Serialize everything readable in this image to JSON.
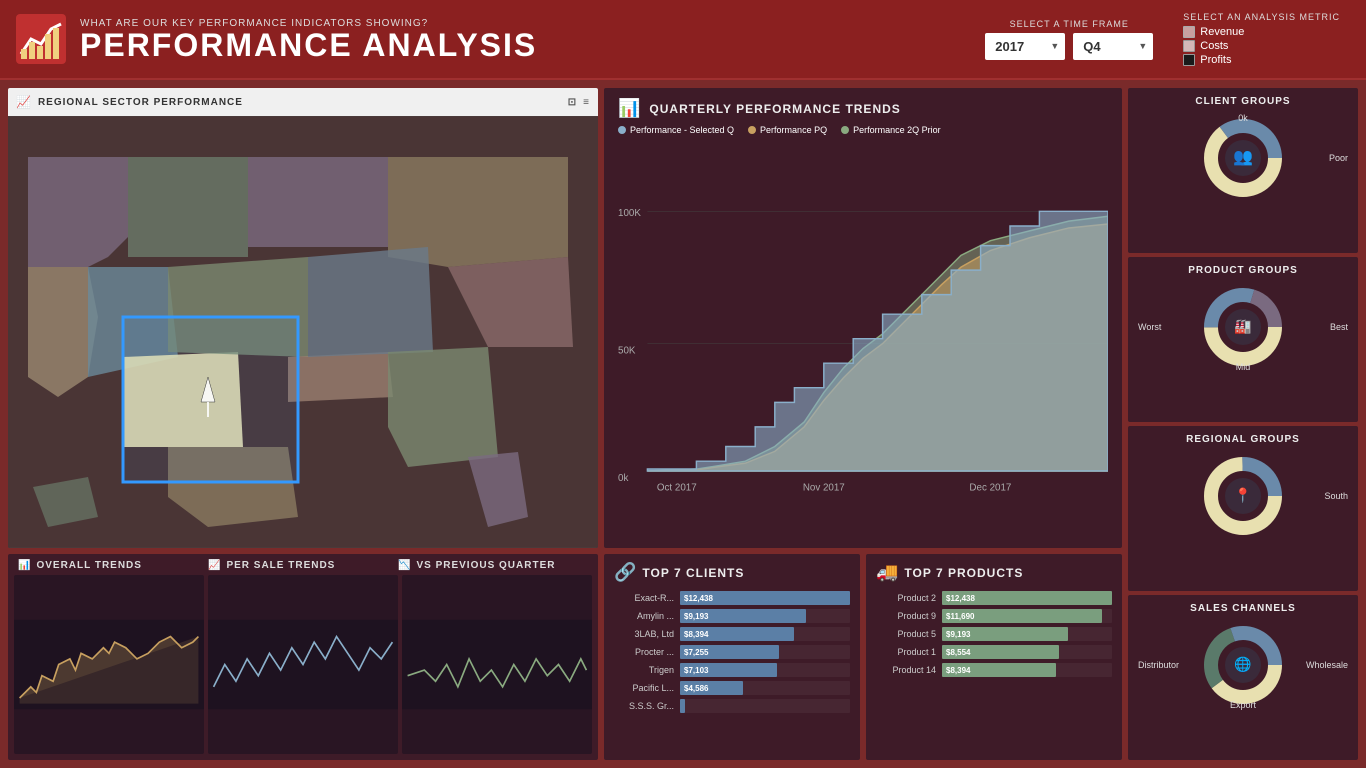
{
  "header": {
    "subtitle": "WHAT ARE OUR KEY PERFORMANCE INDICATORS SHOWING?",
    "title": "PERFORMANCE ANALYSIS",
    "timeframe_label": "SELECT A TIME FRAME",
    "year_value": "2017",
    "quarter_value": "Q4",
    "analysis_label": "SELECT AN ANALYSIS METRIC",
    "metrics": [
      {
        "id": "revenue",
        "label": "Revenue",
        "color": "revenue"
      },
      {
        "id": "costs",
        "label": "Costs",
        "color": "costs"
      },
      {
        "id": "profits",
        "label": "Profits",
        "color": "profits"
      }
    ]
  },
  "map_panel": {
    "title": "REGIONAL SECTOR PERFORMANCE",
    "controls": [
      "⊡",
      "≡"
    ]
  },
  "quarterly_trends": {
    "title": "QUARTERLY PERFORMANCE TRENDS",
    "legend": [
      {
        "label": "Performance - Selected Q",
        "color": "#8aafca"
      },
      {
        "label": "Performance PQ",
        "color": "#c8a060"
      },
      {
        "label": "Performance 2Q Prior",
        "color": "#8aaa80"
      }
    ],
    "x_labels": [
      "Oct 2017",
      "Nov 2017",
      "Dec 2017"
    ],
    "y_labels": [
      "0k",
      "50K",
      "100K"
    ]
  },
  "client_groups": {
    "title": "CLIENT GROUPS",
    "labels": {
      "top": "0k",
      "right": "Poor"
    },
    "icon": "👥"
  },
  "product_groups": {
    "title": "PRODUCT GROUPS",
    "labels": {
      "left": "Worst",
      "right": "Best",
      "bottom": "Mid"
    },
    "icon": "🏭"
  },
  "regional_groups": {
    "title": "REGIONAL GROUPS",
    "labels": {
      "right": "South"
    },
    "icon": "📍"
  },
  "sales_channels": {
    "title": "SALES CHANNELS",
    "labels": {
      "left": "Distributor",
      "right": "Wholesale",
      "bottom": "Export"
    },
    "icon": "🌐"
  },
  "bottom_charts": {
    "titles": [
      "OVERALL TRENDS",
      "PER SALE TRENDS",
      "VS PREVIOUS QUARTER"
    ]
  },
  "top7_clients": {
    "title": "TOP 7 CLIENTS",
    "max_value": 12438,
    "items": [
      {
        "name": "Exact-R...",
        "value": "$12,438",
        "raw": 12438
      },
      {
        "name": "Amylin ...",
        "value": "$9,193",
        "raw": 9193
      },
      {
        "name": "3LAB, Ltd",
        "value": "$8,394",
        "raw": 8394
      },
      {
        "name": "Procter ...",
        "value": "$7,255",
        "raw": 7255
      },
      {
        "name": "Trigen",
        "value": "$7,103",
        "raw": 7103
      },
      {
        "name": "Pacific L...",
        "value": "$4,586",
        "raw": 4586
      },
      {
        "name": "S.S.S. Gr...",
        "value": "",
        "raw": 400
      }
    ]
  },
  "top7_products": {
    "title": "TOP 7 PRODUCTS",
    "max_value": 12438,
    "items": [
      {
        "name": "Product 2",
        "value": "$12,438",
        "raw": 12438
      },
      {
        "name": "Product 9",
        "value": "$11,690",
        "raw": 11690
      },
      {
        "name": "Product 5",
        "value": "$9,193",
        "raw": 9193
      },
      {
        "name": "Product 1",
        "value": "$8,554",
        "raw": 8554
      },
      {
        "name": "Product 14",
        "value": "$8,394",
        "raw": 8394
      }
    ]
  }
}
